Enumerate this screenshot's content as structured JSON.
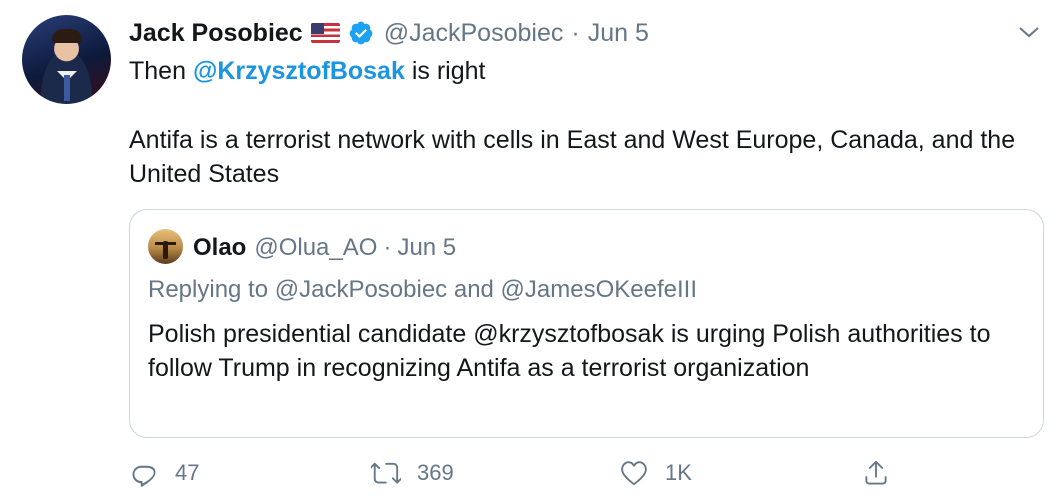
{
  "tweet": {
    "author_name": "Jack Posobiec",
    "author_handle": "@JackPosobiec",
    "separator": "·",
    "date": "Jun 5",
    "text_prefix": "Then ",
    "text_mention": "@KrzysztofBosak",
    "text_suffix": " is right",
    "text_body": "Antifa is a terrorist network with cells in East and West Europe, Canada, and the United States",
    "icons": {
      "flag": "us-flag-icon",
      "verified": "verified-badge-icon",
      "menu": "chevron-down-icon"
    }
  },
  "quoted": {
    "author_name": "Olao",
    "author_handle": "@Olua_AO",
    "separator": "·",
    "date": "Jun 5",
    "replying_to": "Replying to @JackPosobiec and @JamesOKeefeIII",
    "text": "Polish presidential candidate @krzysztofbosak is urging Polish authorities to follow Trump in recognizing Antifa as a terrorist organization"
  },
  "actions": {
    "reply_count": "47",
    "retweet_count": "369",
    "like_count": "1K",
    "icons": [
      "reply-icon",
      "retweet-icon",
      "like-icon",
      "share-icon"
    ]
  },
  "colors": {
    "accent": "#1b95e0",
    "muted": "#657786",
    "text": "#14171a",
    "border": "#ccd6dd"
  }
}
